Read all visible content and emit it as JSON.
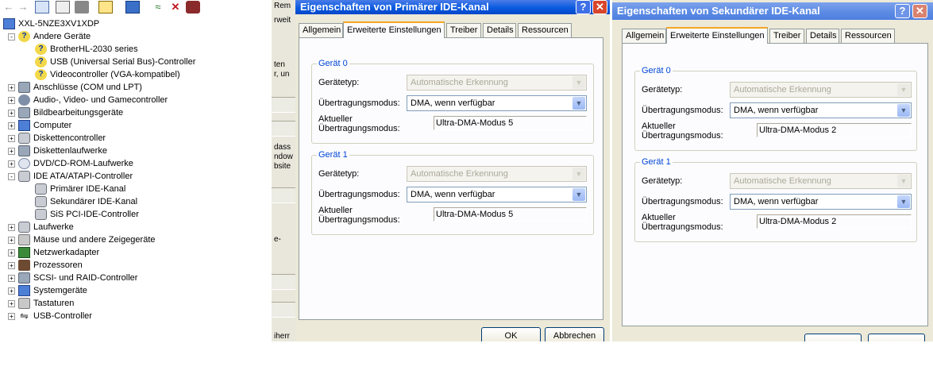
{
  "device_manager": {
    "toolbar_icons": [
      "back-arrow-icon",
      "forward-arrow-icon",
      "show-hide-tree-icon",
      "properties-icon",
      "print-icon",
      "help-icon",
      "scan-hardware-icon",
      "update-driver-icon",
      "uninstall-icon",
      "disable-icon"
    ],
    "tree": [
      {
        "label": "XXL-5NZE3XV1XDP",
        "icon": "computer-icon",
        "level": 0,
        "expander": ""
      },
      {
        "label": "Andere Geräte",
        "icon": "warning-devices-icon",
        "level": 1,
        "expander": "-"
      },
      {
        "label": "BrotherHL-2030 series",
        "icon": "unknown-device-icon",
        "level": 2,
        "expander": ""
      },
      {
        "label": "USB (Universal Serial Bus)-Controller",
        "icon": "unknown-device-icon",
        "level": 2,
        "expander": ""
      },
      {
        "label": "Videocontroller (VGA-kompatibel)",
        "icon": "unknown-device-icon",
        "level": 2,
        "expander": ""
      },
      {
        "label": "Anschlüsse (COM und LPT)",
        "icon": "ports-icon",
        "level": 1,
        "expander": "+"
      },
      {
        "label": "Audio-, Video- und Gamecontroller",
        "icon": "audio-icon",
        "level": 1,
        "expander": "+"
      },
      {
        "label": "Bildbearbeitungsgeräte",
        "icon": "camera-icon",
        "level": 1,
        "expander": "+"
      },
      {
        "label": "Computer",
        "icon": "computer-icon",
        "level": 1,
        "expander": "+"
      },
      {
        "label": "Diskettencontroller",
        "icon": "controller-icon",
        "level": 1,
        "expander": "+"
      },
      {
        "label": "Diskettenlaufwerke",
        "icon": "floppy-icon",
        "level": 1,
        "expander": "+"
      },
      {
        "label": "DVD/CD-ROM-Laufwerke",
        "icon": "dvd-icon",
        "level": 1,
        "expander": "+"
      },
      {
        "label": "IDE ATA/ATAPI-Controller",
        "icon": "controller-icon",
        "level": 1,
        "expander": "-"
      },
      {
        "label": "Primärer IDE-Kanal",
        "icon": "controller-icon",
        "level": 2,
        "expander": ""
      },
      {
        "label": "Sekundärer IDE-Kanal",
        "icon": "controller-icon",
        "level": 2,
        "expander": ""
      },
      {
        "label": "SiS PCI-IDE-Controller",
        "icon": "controller-icon",
        "level": 2,
        "expander": ""
      },
      {
        "label": "Laufwerke",
        "icon": "drive-icon",
        "level": 1,
        "expander": "+"
      },
      {
        "label": "Mäuse und andere Zeigegeräte",
        "icon": "mouse-icon",
        "level": 1,
        "expander": "+"
      },
      {
        "label": "Netzwerkadapter",
        "icon": "network-adapter-icon",
        "level": 1,
        "expander": "+"
      },
      {
        "label": "Prozessoren",
        "icon": "processor-icon",
        "level": 1,
        "expander": "+"
      },
      {
        "label": "SCSI- und RAID-Controller",
        "icon": "scsi-icon",
        "level": 1,
        "expander": "+"
      },
      {
        "label": "Systemgeräte",
        "icon": "system-devices-icon",
        "level": 1,
        "expander": "+"
      },
      {
        "label": "Tastaturen",
        "icon": "keyboard-icon",
        "level": 1,
        "expander": "+"
      },
      {
        "label": "USB-Controller",
        "icon": "usb-icon",
        "level": 1,
        "expander": "+"
      }
    ]
  },
  "background_window": {
    "fragments": [
      "Rem",
      "rweit",
      "ten",
      "r, un",
      "dass",
      "ndow",
      "bsite",
      "e-",
      "iherr"
    ]
  },
  "dialog_primary": {
    "title": "Eigenschaften von Primärer IDE-Kanal",
    "help_symbol": "?",
    "close_symbol": "✕",
    "tabs": [
      "Allgemein",
      "Erweiterte Einstellungen",
      "Treiber",
      "Details",
      "Ressourcen"
    ],
    "active_tab": "Erweiterte Einstellungen",
    "devices": [
      {
        "group": "Gerät 0",
        "type_label": "Gerätetyp:",
        "type_value": "Automatische Erkennung",
        "mode_label": "Übertragungsmodus:",
        "mode_value": "DMA, wenn verfügbar",
        "current_label_1": "Aktueller",
        "current_label_2": "Übertragungsmodus:",
        "current_value": "Ultra-DMA-Modus 5"
      },
      {
        "group": "Gerät 1",
        "type_label": "Gerätetyp:",
        "type_value": "Automatische Erkennung",
        "mode_label": "Übertragungsmodus:",
        "mode_value": "DMA, wenn verfügbar",
        "current_label_1": "Aktueller",
        "current_label_2": "Übertragungsmodus:",
        "current_value": "Ultra-DMA-Modus 5"
      }
    ],
    "buttons": {
      "ok": "OK",
      "cancel": "Abbrechen"
    }
  },
  "dialog_secondary": {
    "title": "Eigenschaften von Sekundärer IDE-Kanal",
    "help_symbol": "?",
    "close_symbol": "✕",
    "tabs": [
      "Allgemein",
      "Erweiterte Einstellungen",
      "Treiber",
      "Details",
      "Ressourcen"
    ],
    "active_tab": "Erweiterte Einstellungen",
    "devices": [
      {
        "group": "Gerät 0",
        "type_label": "Gerätetyp:",
        "type_value": "Automatische Erkennung",
        "mode_label": "Übertragungsmodus:",
        "mode_value": "DMA, wenn verfügbar",
        "current_label_1": "Aktueller",
        "current_label_2": "Übertragungsmodus:",
        "current_value": "Ultra-DMA-Modus 2"
      },
      {
        "group": "Gerät 1",
        "type_label": "Gerätetyp:",
        "type_value": "Automatische Erkennung",
        "mode_label": "Übertragungsmodus:",
        "mode_value": "DMA, wenn verfügbar",
        "current_label_1": "Aktueller",
        "current_label_2": "Übertragungsmodus:",
        "current_value": "Ultra-DMA-Modus 2"
      }
    ]
  }
}
